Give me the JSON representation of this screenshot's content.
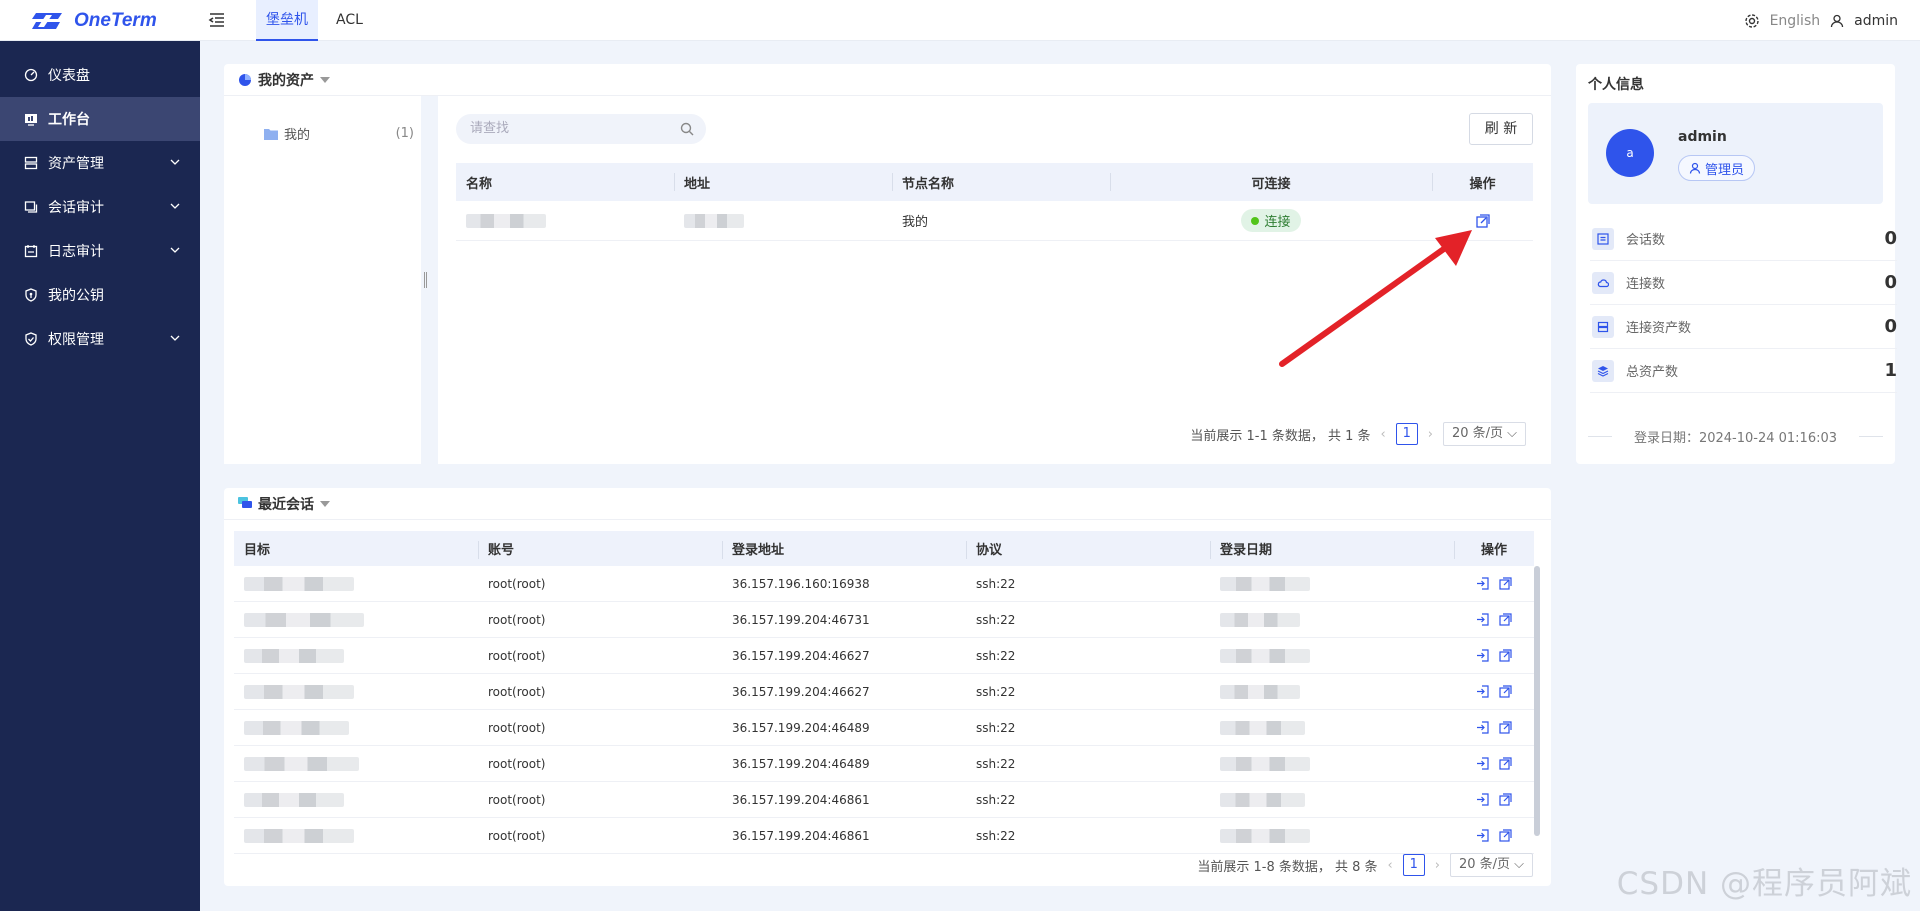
{
  "app": {
    "name": "OneTerm"
  },
  "top_tabs": [
    {
      "label": "堡垒机",
      "active": true
    },
    {
      "label": "ACL",
      "active": false
    }
  ],
  "topbar": {
    "language": "English",
    "user": "admin"
  },
  "sidebar": {
    "items": [
      {
        "label": "仪表盘",
        "icon": "dashboard-icon",
        "expandable": false,
        "active": false
      },
      {
        "label": "工作台",
        "icon": "workbench-icon",
        "expandable": false,
        "active": true
      },
      {
        "label": "资产管理",
        "icon": "asset-icon",
        "expandable": true,
        "active": false
      },
      {
        "label": "会话审计",
        "icon": "session-icon",
        "expandable": true,
        "active": false
      },
      {
        "label": "日志审计",
        "icon": "log-icon",
        "expandable": true,
        "active": false
      },
      {
        "label": "我的公钥",
        "icon": "key-icon",
        "expandable": false,
        "active": false
      },
      {
        "label": "权限管理",
        "icon": "shield-icon",
        "expandable": true,
        "active": false
      }
    ]
  },
  "my_assets": {
    "title": "我的资产",
    "tree": {
      "node_label": "我的",
      "count": "(1)"
    },
    "search_placeholder": "请查找",
    "refresh_label": "刷 新",
    "columns": [
      "名称",
      "地址",
      "节点名称",
      "可连接",
      "操作"
    ],
    "rows": [
      {
        "name": "",
        "address": "",
        "node": "我的",
        "status": "连接"
      }
    ],
    "pagination": {
      "summary": "当前展示 1-1 条数据， 共 1 条",
      "page": "1",
      "page_size": "20 条/页"
    }
  },
  "recent_sessions": {
    "title": "最近会话",
    "columns": [
      "目标",
      "账号",
      "登录地址",
      "协议",
      "登录日期",
      "操作"
    ],
    "rows": [
      {
        "target": "",
        "account": "root(root)",
        "address": "36.157.196.160:16938",
        "protocol": "ssh:22",
        "date": ""
      },
      {
        "target": "",
        "account": "root(root)",
        "address": "36.157.199.204:46731",
        "protocol": "ssh:22",
        "date": ""
      },
      {
        "target": "",
        "account": "root(root)",
        "address": "36.157.199.204:46627",
        "protocol": "ssh:22",
        "date": ""
      },
      {
        "target": "",
        "account": "root(root)",
        "address": "36.157.199.204:46627",
        "protocol": "ssh:22",
        "date": ""
      },
      {
        "target": "",
        "account": "root(root)",
        "address": "36.157.199.204:46489",
        "protocol": "ssh:22",
        "date": ""
      },
      {
        "target": "",
        "account": "root(root)",
        "address": "36.157.199.204:46489",
        "protocol": "ssh:22",
        "date": ""
      },
      {
        "target": "",
        "account": "root(root)",
        "address": "36.157.199.204:46861",
        "protocol": "ssh:22",
        "date": ""
      },
      {
        "target": "",
        "account": "root(root)",
        "address": "36.157.199.204:46861",
        "protocol": "ssh:22",
        "date": ""
      }
    ],
    "pagination": {
      "summary": "当前展示 1-8 条数据， 共 8 条",
      "page": "1",
      "page_size": "20 条/页"
    }
  },
  "profile": {
    "title": "个人信息",
    "avatar_letter": "a",
    "username": "admin",
    "role": "管理员",
    "stats": [
      {
        "label": "会话数",
        "value": "0"
      },
      {
        "label": "连接数",
        "value": "0"
      },
      {
        "label": "连接资产数",
        "value": "0"
      },
      {
        "label": "总资产数",
        "value": "1"
      }
    ],
    "login_date": "登录日期：2024-10-24 01:16:03"
  },
  "watermark": "CSDN @程序员阿斌",
  "colors": {
    "primary": "#2f54eb",
    "sidebar": "#1b2751",
    "sidebar_active": "#3b4672",
    "arrow": "#e32228"
  }
}
